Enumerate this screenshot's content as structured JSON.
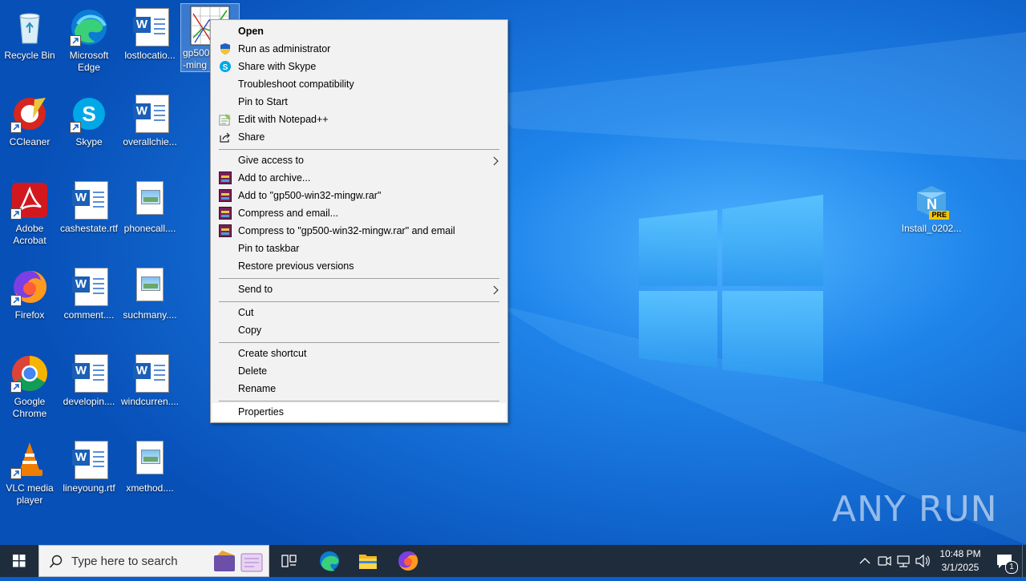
{
  "desktop_icons": [
    {
      "label": "Recycle Bin"
    },
    {
      "label": "Microsoft Edge"
    },
    {
      "label": "lostlocatio..."
    },
    {
      "label": "gp500\n-ming"
    },
    {
      "label": "CCleaner"
    },
    {
      "label": "Skype"
    },
    {
      "label": "overallchie..."
    },
    {
      "label": "Adobe Acrobat"
    },
    {
      "label": "cashestate.rtf"
    },
    {
      "label": "phonecall...."
    },
    {
      "label": "Firefox"
    },
    {
      "label": "comment...."
    },
    {
      "label": "suchmany...."
    },
    {
      "label": "Google Chrome"
    },
    {
      "label": "developin...."
    },
    {
      "label": "windcurren...."
    },
    {
      "label": "VLC media player"
    },
    {
      "label": "lineyoung.rtf"
    },
    {
      "label": "xmethod...."
    },
    {
      "label": "Install_0202..."
    }
  ],
  "notion_badge": "PRE",
  "context_menu": {
    "items": [
      {
        "label": "Open",
        "icon": "none"
      },
      {
        "label": "Run as administrator",
        "icon": "uac-shield-icon"
      },
      {
        "label": "Share with Skype",
        "icon": "skype-icon"
      },
      {
        "label": "Troubleshoot compatibility",
        "icon": "none"
      },
      {
        "label": "Pin to Start",
        "icon": "none"
      },
      {
        "label": "Edit with Notepad++",
        "icon": "notepadpp-icon"
      },
      {
        "label": "Share",
        "icon": "share-icon"
      },
      {
        "label": "Give access to",
        "icon": "none"
      },
      {
        "label": "Add to archive...",
        "icon": "winrar-icon"
      },
      {
        "label": "Add to \"gp500-win32-mingw.rar\"",
        "icon": "winrar-icon"
      },
      {
        "label": "Compress and email...",
        "icon": "winrar-icon"
      },
      {
        "label": "Compress to \"gp500-win32-mingw.rar\" and email",
        "icon": "winrar-icon"
      },
      {
        "label": "Pin to taskbar",
        "icon": "none"
      },
      {
        "label": "Restore previous versions",
        "icon": "none"
      },
      {
        "label": "Send to",
        "icon": "none"
      },
      {
        "label": "Cut",
        "icon": "none"
      },
      {
        "label": "Copy",
        "icon": "none"
      },
      {
        "label": "Create shortcut",
        "icon": "none"
      },
      {
        "label": "Delete",
        "icon": "none"
      },
      {
        "label": "Rename",
        "icon": "none"
      },
      {
        "label": "Properties",
        "icon": "none"
      }
    ]
  },
  "taskbar": {
    "search_placeholder": "Type here to search",
    "time": "10:48 PM",
    "date": "3/1/2025",
    "notification_count": "1"
  },
  "watermark": "ANY RUN",
  "colors": {
    "desktop": "#0a5fd0",
    "taskbar": "#1f2c3c",
    "menu": "#f2f2f2"
  }
}
